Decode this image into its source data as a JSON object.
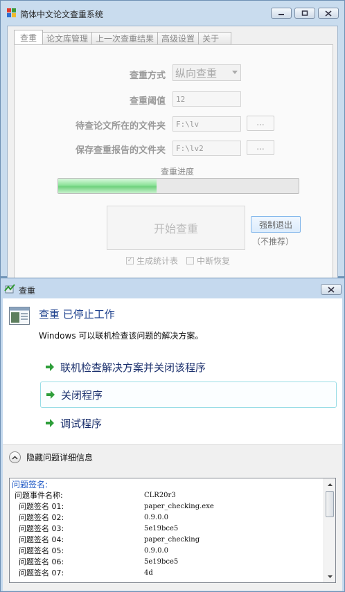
{
  "app": {
    "title": "简体中文论文查重系统",
    "tabs": [
      "查重",
      "论文库管理",
      "上一次查重结果",
      "高级设置",
      "关于"
    ],
    "form": {
      "method_label": "查重方式",
      "method_value": "纵向查重",
      "threshold_label": "查重阈值",
      "threshold_value": "12",
      "input_folder_label": "待查论文所在的文件夹",
      "input_folder_value": "F:\\lv",
      "output_folder_label": "保存查重报告的文件夹",
      "output_folder_value": "F:\\lv2",
      "browse_label": "...",
      "progress_label": "查重进度",
      "progress_fraction": 0.41,
      "start_button": "开始查重",
      "force_exit_button": "强制退出",
      "force_exit_note": "（不推荐）",
      "gen_stats_label": "生成统计表",
      "gen_stats_checked": true,
      "resume_label": "中断恢复",
      "resume_checked": false
    }
  },
  "dialog": {
    "title": "查重",
    "heading": "查重 已停止工作",
    "subtext": "Windows 可以联机检查该问题的解决方案。",
    "commands": [
      "联机检查解决方案并关闭该程序",
      "关闭程序",
      "调试程序"
    ],
    "toggle_label": "隐藏问题详细信息",
    "details_header": "问题签名:",
    "details": [
      {
        "key": "问题事件名称:",
        "value": "CLR20r3"
      },
      {
        "key": "问题签名 01:",
        "value": "paper_checking.exe"
      },
      {
        "key": "问题签名 02:",
        "value": "0.9.0.0"
      },
      {
        "key": "问题签名 03:",
        "value": "5e19bce5"
      },
      {
        "key": "问题签名 04:",
        "value": "paper_checking"
      },
      {
        "key": "问题签名 05:",
        "value": "0.9.0.0"
      },
      {
        "key": "问题签名 06:",
        "value": "5e19bce5"
      },
      {
        "key": "问题签名 07:",
        "value": "4d"
      }
    ]
  }
}
